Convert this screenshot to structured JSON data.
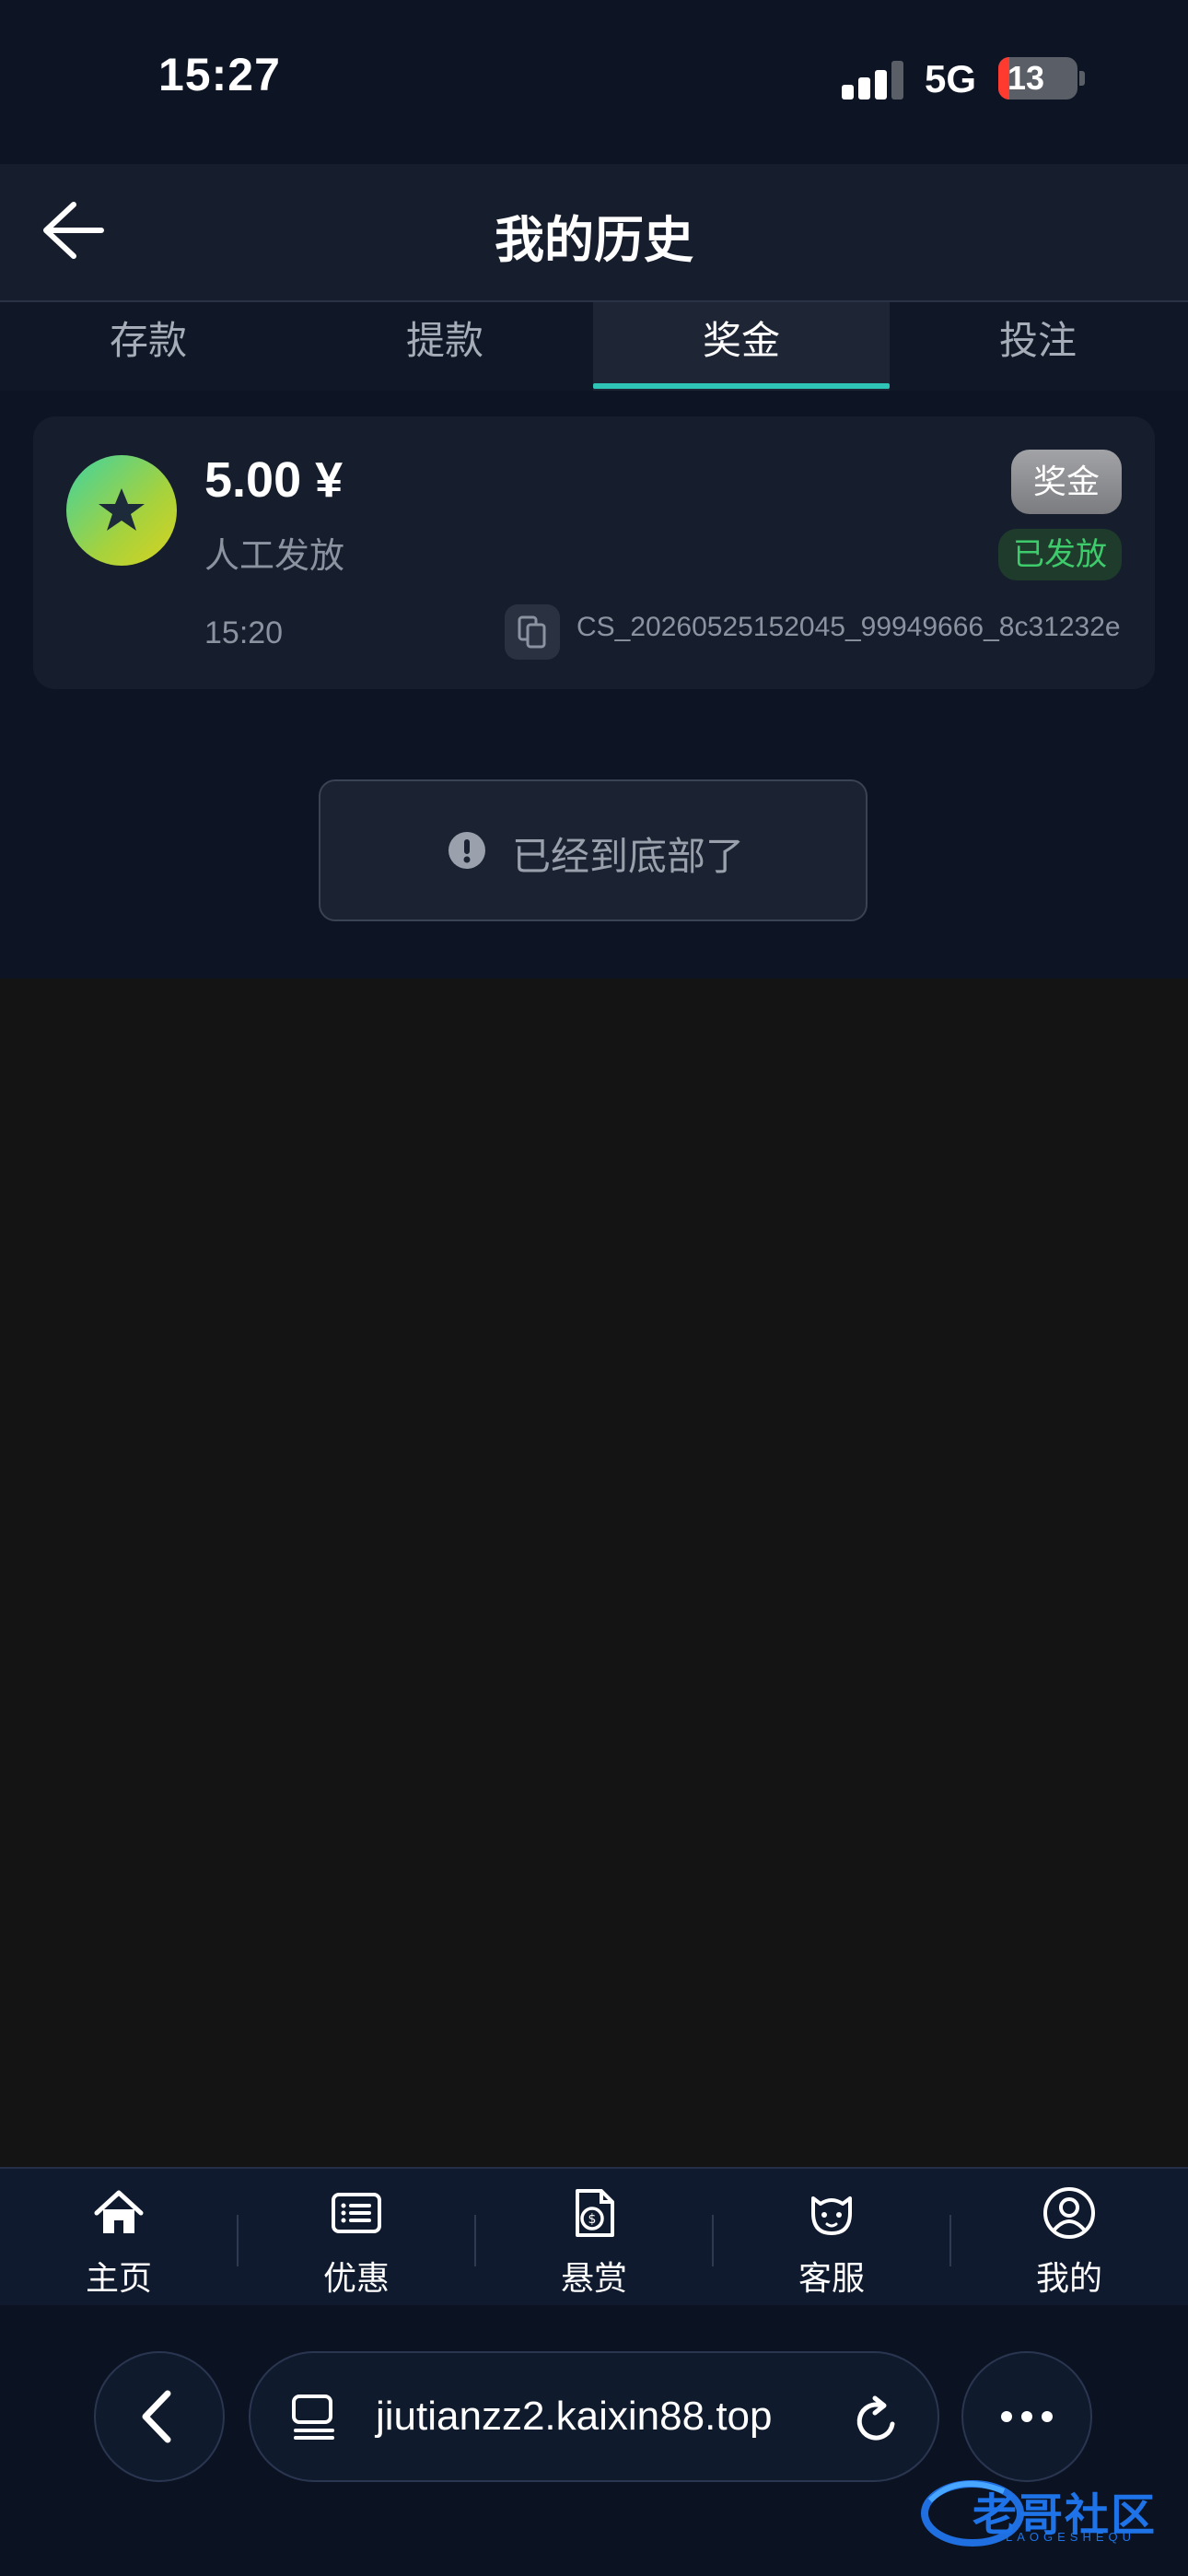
{
  "status_bar": {
    "time": "15:27",
    "network": "5G",
    "battery": "13"
  },
  "header": {
    "title": "我的历史"
  },
  "tabs": [
    {
      "label": "存款",
      "active": false
    },
    {
      "label": "提款",
      "active": false
    },
    {
      "label": "奖金",
      "active": true
    },
    {
      "label": "投注",
      "active": false
    }
  ],
  "record": {
    "amount": "5.00 ¥",
    "description": "人工发放",
    "time": "15:20",
    "type_badge": "奖金",
    "status_badge": "已发放",
    "order_id": "CS_20260525152045_99949666_8c31232e"
  },
  "end_message": "已经到底部了",
  "bottom_nav": [
    {
      "label": "主页",
      "icon": "home-icon"
    },
    {
      "label": "优惠",
      "icon": "list-icon"
    },
    {
      "label": "悬赏",
      "icon": "coin-document-icon"
    },
    {
      "label": "客服",
      "icon": "customer-service-icon"
    },
    {
      "label": "我的",
      "icon": "user-icon"
    }
  ],
  "browser": {
    "url": "jiutianzz2.kaixin88.top"
  },
  "watermark": {
    "text": "老哥社区",
    "subtext": "LAOGESHEQU"
  },
  "colors": {
    "accent": "#2ec4b6",
    "success": "#3ecb6b",
    "background": "#0d1424"
  }
}
